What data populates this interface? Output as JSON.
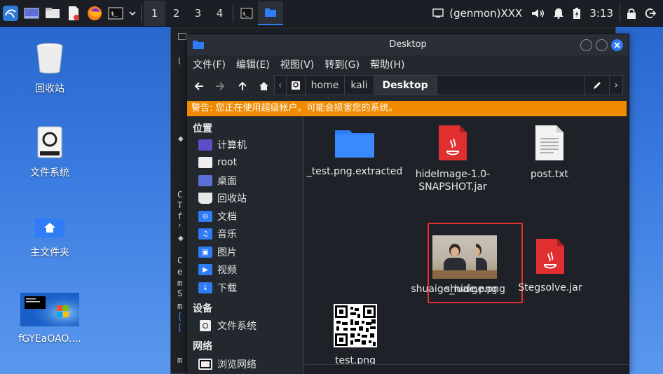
{
  "panel": {
    "workspaces": [
      "1",
      "2",
      "3",
      "4"
    ],
    "genmon": "(genmon)XXX",
    "clock": "3:13"
  },
  "desktop": {
    "icons": [
      {
        "label": "回收站"
      },
      {
        "label": "文件系统"
      },
      {
        "label": "主文件夹"
      },
      {
        "label": "fGYEaOAO...."
      }
    ]
  },
  "terminal": {
    "fragments": [
      "C",
      "T",
      "f",
      "'",
      "C",
      "e",
      "m",
      "S",
      "m",
      "[",
      "[",
      "m"
    ]
  },
  "window": {
    "title": "Desktop",
    "menu": [
      "文件(F)",
      "编辑(E)",
      "视图(V)",
      "转到(G)",
      "帮助(H)"
    ],
    "path": [
      "home",
      "kali",
      "Desktop"
    ],
    "warning": "警告: 您正在使用超级帐户。可能会损害您的系统。"
  },
  "sidebar": {
    "places_title": "位置",
    "places": [
      "计算机",
      "root",
      "桌面",
      "回收站",
      "文档",
      "音乐",
      "图片",
      "视频",
      "下载"
    ],
    "devices_title": "设备",
    "devices": [
      "文件系统"
    ],
    "network_title": "网络",
    "network": [
      "浏览网络"
    ]
  },
  "files": [
    {
      "name": "_test.png.extracted",
      "type": "folder"
    },
    {
      "name": "hideImage-1.0-SNAPSHOT.jar",
      "type": "jar"
    },
    {
      "name": "post.txt",
      "type": "text"
    },
    {
      "name": "shuaige.png",
      "type": "image",
      "selected": true
    },
    {
      "name": "shuaige_hide.png",
      "type": "image"
    },
    {
      "name": "Stegsolve.jar",
      "type": "jar"
    },
    {
      "name": "test.png",
      "type": "qr"
    }
  ],
  "colors": {
    "panel_bg": "#1b1e24",
    "window_bg": "#23272e",
    "warning_bg": "#f08a00",
    "accent": "#2f7cf6",
    "selection_outline": "#e03030"
  }
}
